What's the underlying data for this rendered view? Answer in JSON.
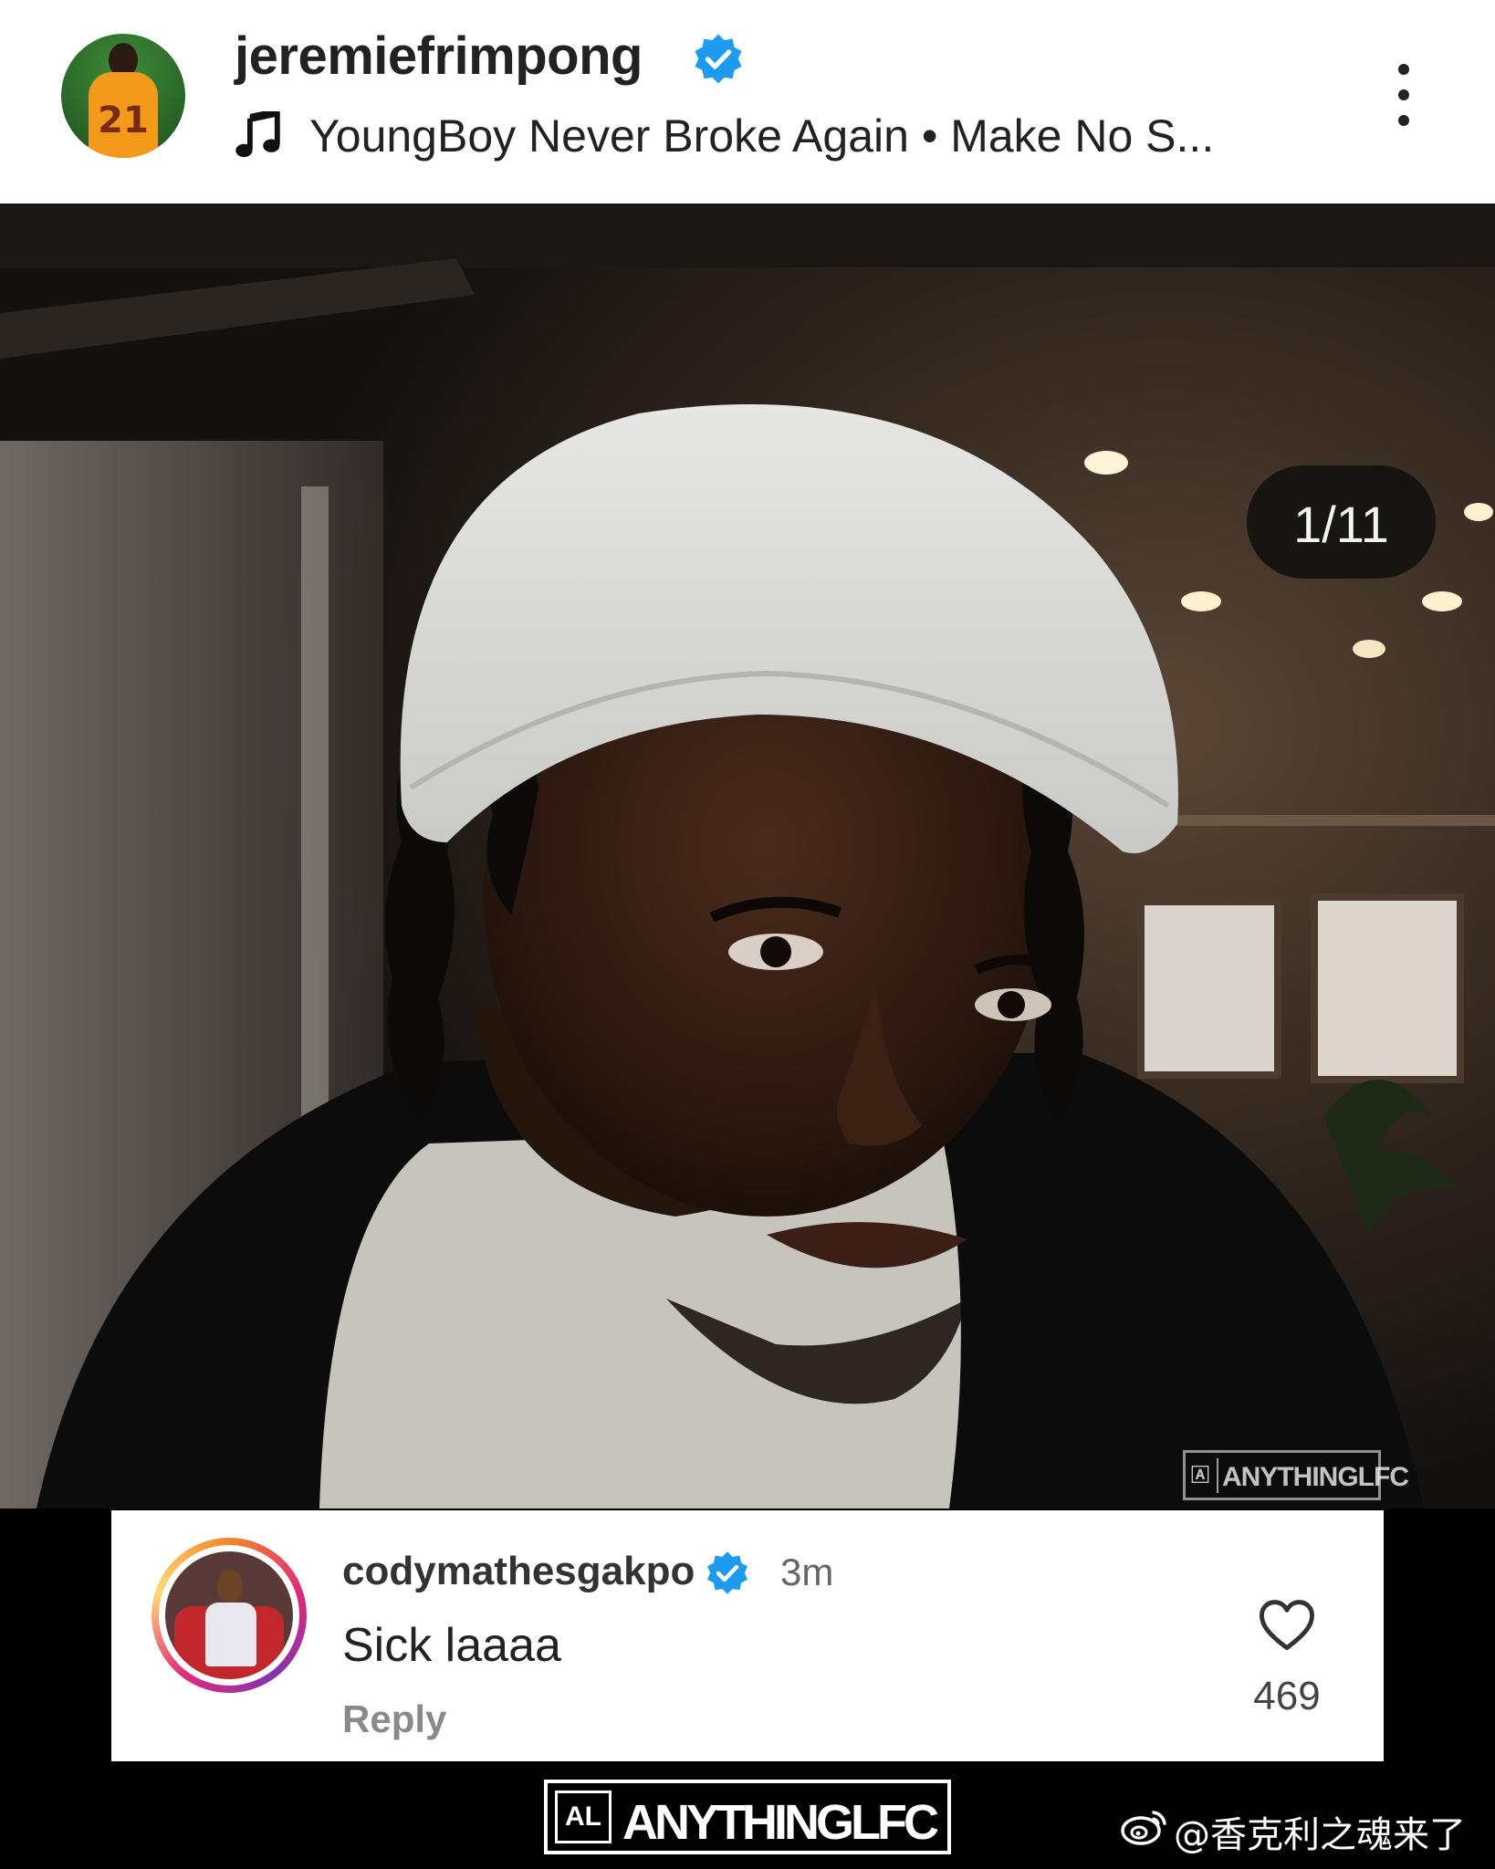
{
  "header": {
    "username": "jeremiefrimpong",
    "verified": true,
    "music": "YoungBoy Never Broke Again • Make No S...",
    "avatar_number": "21"
  },
  "post": {
    "counter": "1/11",
    "watermark": "ANYTHINGLFC"
  },
  "comment": {
    "username": "codymathesgakpo",
    "verified": true,
    "time": "3m",
    "text": "Sick laaaa",
    "reply_label": "Reply",
    "likes": "469"
  },
  "footer": {
    "logo_text": "ANYTHINGLFC",
    "logo_symbol": "AL",
    "weibo_handle": "@香克利之魂来了"
  },
  "colors": {
    "verified_blue": "#1d9bf0",
    "header_bg": "#ffffff",
    "page_bg": "#000000"
  },
  "icons": [
    "verified-badge-icon",
    "music-note-icon",
    "more-options-icon",
    "heart-icon",
    "weibo-icon"
  ]
}
